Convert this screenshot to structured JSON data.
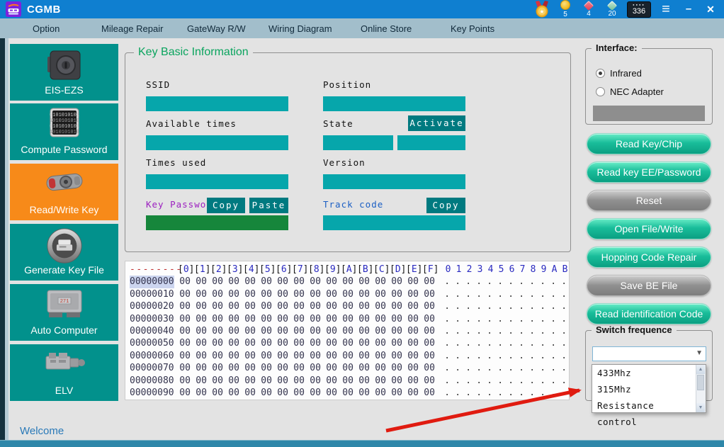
{
  "titlebar": {
    "title": "CGMB",
    "stats": {
      "coins": "5",
      "red_gems": "4",
      "green_gems": "20",
      "counter": "336"
    },
    "controls": {
      "menu": "≡",
      "minimize": "–",
      "close": "✕"
    }
  },
  "menubar": {
    "items": [
      "Option",
      "Mileage Repair",
      "GateWay R/W",
      "Wiring Diagram",
      "Online Store",
      "Key Points"
    ]
  },
  "sidebar": {
    "items": [
      {
        "label": "EIS-EZS",
        "icon": "ignition-lock-icon",
        "active": false
      },
      {
        "label": "Compute Password",
        "icon": "binary-screen-icon",
        "active": false
      },
      {
        "label": "Read/Write Key",
        "icon": "key-fob-icon",
        "active": true
      },
      {
        "label": "Generate Key File",
        "icon": "printer-icon",
        "active": false
      },
      {
        "label": "Auto Computer",
        "icon": "ecu-icon",
        "active": false
      },
      {
        "label": "ELV",
        "icon": "elv-module-icon",
        "active": false
      }
    ]
  },
  "key_info": {
    "title": "Key Basic Information",
    "ssid": {
      "label": "SSID",
      "value": ""
    },
    "available_times": {
      "label": "Available times",
      "value": ""
    },
    "times_used": {
      "label": "Times used",
      "value": ""
    },
    "key_password": {
      "label": "Key Password",
      "value": "",
      "copy": "Copy",
      "paste": "Paste"
    },
    "position": {
      "label": "Position",
      "value": ""
    },
    "state": {
      "label": "State",
      "activate": "Activate",
      "value1": "",
      "value2": ""
    },
    "version": {
      "label": "Version",
      "value": ""
    },
    "track_code": {
      "label": "Track code",
      "copy": "Copy",
      "value": ""
    }
  },
  "hex_view": {
    "header_addr": "--------",
    "header_cols": [
      "0",
      "1",
      "2",
      "3",
      "4",
      "5",
      "6",
      "7",
      "8",
      "9",
      "A",
      "B",
      "C",
      "D",
      "E",
      "F"
    ],
    "header_ascii": [
      "0",
      "1",
      "2",
      "3",
      "4",
      "5",
      "6",
      "7",
      "8",
      "9",
      "A",
      "B"
    ],
    "rows": [
      {
        "addr": "00000000",
        "sel": "sel",
        "bytes": [
          "00",
          "00",
          "00",
          "00",
          "00",
          "00",
          "00",
          "00",
          "00",
          "00",
          "00",
          "00",
          "00",
          "00",
          "00",
          "00"
        ],
        "ascii": [
          ".",
          ".",
          ".",
          ".",
          ".",
          ".",
          ".",
          ".",
          ".",
          ".",
          ".",
          "."
        ]
      },
      {
        "addr": "00000010",
        "sel": "",
        "bytes": [
          "00",
          "00",
          "00",
          "00",
          "00",
          "00",
          "00",
          "00",
          "00",
          "00",
          "00",
          "00",
          "00",
          "00",
          "00",
          "00"
        ],
        "ascii": [
          ".",
          ".",
          ".",
          ".",
          ".",
          ".",
          ".",
          ".",
          ".",
          ".",
          ".",
          "."
        ]
      },
      {
        "addr": "00000020",
        "sel": "",
        "bytes": [
          "00",
          "00",
          "00",
          "00",
          "00",
          "00",
          "00",
          "00",
          "00",
          "00",
          "00",
          "00",
          "00",
          "00",
          "00",
          "00"
        ],
        "ascii": [
          ".",
          ".",
          ".",
          ".",
          ".",
          ".",
          ".",
          ".",
          ".",
          ".",
          ".",
          "."
        ]
      },
      {
        "addr": "00000030",
        "sel": "",
        "bytes": [
          "00",
          "00",
          "00",
          "00",
          "00",
          "00",
          "00",
          "00",
          "00",
          "00",
          "00",
          "00",
          "00",
          "00",
          "00",
          "00"
        ],
        "ascii": [
          ".",
          ".",
          ".",
          ".",
          ".",
          ".",
          ".",
          ".",
          ".",
          ".",
          ".",
          "."
        ]
      },
      {
        "addr": "00000040",
        "sel": "",
        "bytes": [
          "00",
          "00",
          "00",
          "00",
          "00",
          "00",
          "00",
          "00",
          "00",
          "00",
          "00",
          "00",
          "00",
          "00",
          "00",
          "00"
        ],
        "ascii": [
          ".",
          ".",
          ".",
          ".",
          ".",
          ".",
          ".",
          ".",
          ".",
          ".",
          ".",
          "."
        ]
      },
      {
        "addr": "00000050",
        "sel": "",
        "bytes": [
          "00",
          "00",
          "00",
          "00",
          "00",
          "00",
          "00",
          "00",
          "00",
          "00",
          "00",
          "00",
          "00",
          "00",
          "00",
          "00"
        ],
        "ascii": [
          ".",
          ".",
          ".",
          ".",
          ".",
          ".",
          ".",
          ".",
          ".",
          ".",
          ".",
          "."
        ]
      },
      {
        "addr": "00000060",
        "sel": "",
        "bytes": [
          "00",
          "00",
          "00",
          "00",
          "00",
          "00",
          "00",
          "00",
          "00",
          "00",
          "00",
          "00",
          "00",
          "00",
          "00",
          "00"
        ],
        "ascii": [
          ".",
          ".",
          ".",
          ".",
          ".",
          ".",
          ".",
          ".",
          ".",
          ".",
          ".",
          "."
        ]
      },
      {
        "addr": "00000070",
        "sel": "",
        "bytes": [
          "00",
          "00",
          "00",
          "00",
          "00",
          "00",
          "00",
          "00",
          "00",
          "00",
          "00",
          "00",
          "00",
          "00",
          "00",
          "00"
        ],
        "ascii": [
          ".",
          ".",
          ".",
          ".",
          ".",
          ".",
          ".",
          ".",
          ".",
          ".",
          ".",
          "."
        ]
      },
      {
        "addr": "00000080",
        "sel": "",
        "bytes": [
          "00",
          "00",
          "00",
          "00",
          "00",
          "00",
          "00",
          "00",
          "00",
          "00",
          "00",
          "00",
          "00",
          "00",
          "00",
          "00"
        ],
        "ascii": [
          ".",
          ".",
          ".",
          ".",
          ".",
          ".",
          ".",
          ".",
          ".",
          ".",
          ".",
          "."
        ]
      },
      {
        "addr": "00000090",
        "sel": "",
        "bytes": [
          "00",
          "00",
          "00",
          "00",
          "00",
          "00",
          "00",
          "00",
          "00",
          "00",
          "00",
          "00",
          "00",
          "00",
          "00",
          "00"
        ],
        "ascii": [
          ".",
          ".",
          ".",
          ".",
          ".",
          ".",
          ".",
          ".",
          ".",
          ".",
          ".",
          "."
        ]
      }
    ]
  },
  "right_panel": {
    "interface": {
      "title": "Interface:",
      "options": [
        {
          "label": "Infrared",
          "state": "selected"
        },
        {
          "label": "NEC Adapter",
          "state": "unselected"
        }
      ]
    },
    "buttons": [
      {
        "label": "Read Key/Chip",
        "style": "green"
      },
      {
        "label": "Read key EE/Password",
        "style": "green"
      },
      {
        "label": "Reset",
        "style": "gray"
      },
      {
        "label": "Open File/Write",
        "style": "green"
      },
      {
        "label": "Hopping Code Repair",
        "style": "green"
      },
      {
        "label": "Save BE File",
        "style": "gray"
      },
      {
        "label": "Read identification Code",
        "style": "green"
      }
    ],
    "switch_frequence": {
      "title": "Switch frequence",
      "value": "",
      "options": [
        "433Mhz",
        "315Mhz",
        "Resistance control"
      ]
    }
  },
  "statusbar": {
    "text": "Welcome"
  },
  "colors": {
    "titlebar_blue": "#0f7fd0",
    "menubar": "#a2becb",
    "sidebar_teal": "#02918c",
    "sidebar_active_orange": "#f78a19",
    "field_teal": "#06a6ab",
    "small_button_teal": "#007a80",
    "password_field_green": "#16863b",
    "group_title_green": "#0aa45e",
    "track_code_blue": "#1b5fc4",
    "key_password_purple": "#9c20c0",
    "arrow_red": "#e01b10"
  }
}
